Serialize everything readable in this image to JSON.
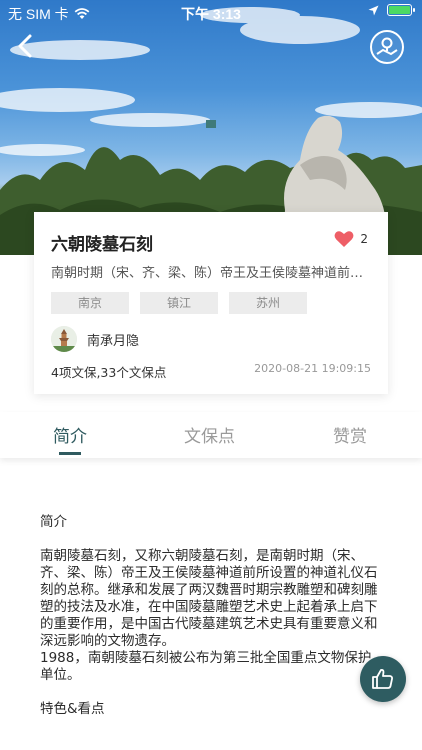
{
  "status_bar": {
    "carrier": "无 SIM 卡",
    "time": "下午 3:13",
    "battery_level": 0.9
  },
  "icons": {
    "back": "back-arrow-icon",
    "map": "map-location-icon",
    "like": "heart-icon",
    "thumb": "thumbs-up-icon"
  },
  "colors": {
    "accent": "#2f5a5f",
    "heart": "#ee5e66",
    "tag_bg": "#ececec"
  },
  "card": {
    "title": "六朝陵墓石刻",
    "like_count": "2",
    "subtitle": "南朝时期（宋、齐、梁、陈）帝王及王侯陵墓神道前所设置的神道礼仪石刻",
    "tags": [
      "南京",
      "镇江",
      "苏州"
    ],
    "author": "南承月隐",
    "stats": "4项文保,33个文保点",
    "date": "2020-08-21 19:09:15"
  },
  "tabs": [
    {
      "label": "简介",
      "active": true
    },
    {
      "label": "文保点",
      "active": false
    },
    {
      "label": "赞赏",
      "active": false
    }
  ],
  "content": {
    "intro_heading": "简介",
    "intro_text": "南朝陵墓石刻，又称六朝陵墓石刻，是南朝时期（宋、齐、梁、陈）帝王及王侯陵墓神道前所设置的神道礼仪石刻的总称。继承和发展了两汉魏晋时期宗教雕塑和碑刻雕塑的技法及水准，在中国陵墓雕塑艺术史上起着承上启下的重要作用，是中国古代陵墓建筑艺术史具有重要意义和深远影响的文物遗存。",
    "intro_text_2": "1988，南朝陵墓石刻被公布为第三批全国重点文物保护单位。",
    "features_heading": "特色&看点"
  }
}
